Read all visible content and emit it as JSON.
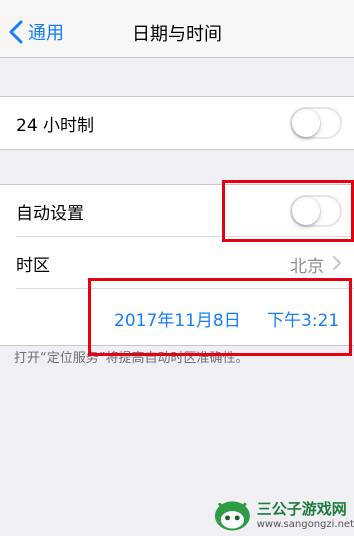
{
  "navbar": {
    "back_label": "通用",
    "title": "日期与时间"
  },
  "settings": {
    "hour24_label": "24 小时制",
    "hour24_on": false,
    "auto_label": "自动设置",
    "auto_on": false,
    "timezone_label": "时区",
    "timezone_value": "北京",
    "date": "2017年11月8日",
    "time": "下午3:21"
  },
  "footer_note": "打开“定位服务”将提高自动时区准确性。",
  "watermark": {
    "title": "三公子游戏网",
    "url": "www.sangongzi.net"
  },
  "colors": {
    "accent": "#157efb",
    "highlight": "#e60012",
    "background": "#efeff4"
  }
}
